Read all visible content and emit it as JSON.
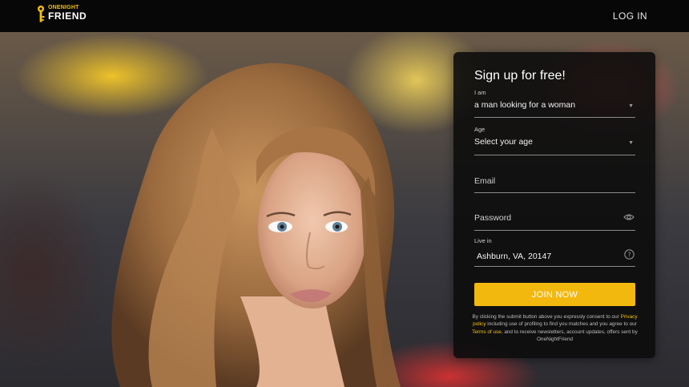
{
  "header": {
    "logo_small": "ONENIGHT",
    "logo_big": "FRIEND",
    "login_label": "LOG IN"
  },
  "signup": {
    "title": "Sign up for free!",
    "iam_label": "I am",
    "iam_value": "a man looking for a woman",
    "age_label": "Age",
    "age_value": "Select your age",
    "email_placeholder": "Email",
    "password_placeholder": "Password",
    "livein_label": "Live in",
    "livein_value": "Ashburn, VA, 20147",
    "join_label": "JOIN NOW"
  },
  "legal": {
    "part1": "By clicking the submit button above you expressly consent to our ",
    "privacy_link": "Privacy policy",
    "part2": " including use of profiling to find you matches and you agree to our ",
    "terms_link": "Terms of use",
    "part3": ", and to receive newsletters, account updates, offers sent by OneNightFriend"
  },
  "colors": {
    "accent": "#f3b80e",
    "topbar": "#070707",
    "card": "#0c0c0c"
  },
  "icons": [
    "key-logo-icon",
    "eye-icon",
    "help-icon",
    "caret-down-icon"
  ]
}
